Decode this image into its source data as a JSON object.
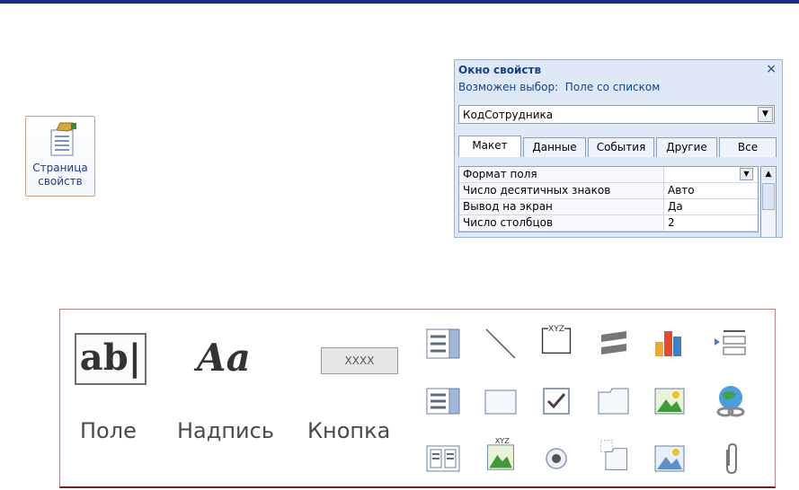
{
  "ribbon_button": {
    "label_line1": "Страница",
    "label_line2": "свойств",
    "icon": "property-sheet-icon"
  },
  "property_sheet": {
    "title": "Окно свойств",
    "close_glyph": "×",
    "selection_prefix": "Возможен выбор:",
    "selection_type": "Поле со списком",
    "object_selector_value": "КодСотрудника",
    "tabs": [
      "Макет",
      "Данные",
      "События",
      "Другие",
      "Все"
    ],
    "active_tab": "Макет",
    "properties": [
      {
        "name": "Формат поля",
        "value": ""
      },
      {
        "name": "Число десятичных знаков",
        "value": "Авто"
      },
      {
        "name": "Вывод на экран",
        "value": "Да"
      },
      {
        "name": "Число столбцов",
        "value": "2"
      }
    ]
  },
  "controls_toolbar": {
    "textbox_glyph": "ab|",
    "textbox_label": "Поле",
    "label_glyph": "Aa",
    "label_label": "Надпись",
    "button_glyph": "XXXX",
    "button_label": "Кнопка",
    "option_group_caption": "XYZ",
    "combo_caption": "XYZ",
    "small_icons": [
      "combo-box-icon",
      "line-icon",
      "option-group-icon",
      "page-break-icon",
      "chart-icon",
      "list-insert-icon",
      "list-box-icon",
      "rectangle-icon",
      "checkbox-icon",
      "tab-control-icon",
      "image-icon",
      "hyperlink-icon",
      "list-view-icon",
      "bound-frame-icon",
      "option-button-icon",
      "subform-icon",
      "image-frame-icon",
      "attachment-icon"
    ]
  },
  "colors": {
    "top_bar": "#1f2a8c",
    "title_text": "#15428b",
    "ribbon_border": "#c9a47a",
    "toolbox_border": "#7a1f1f"
  }
}
